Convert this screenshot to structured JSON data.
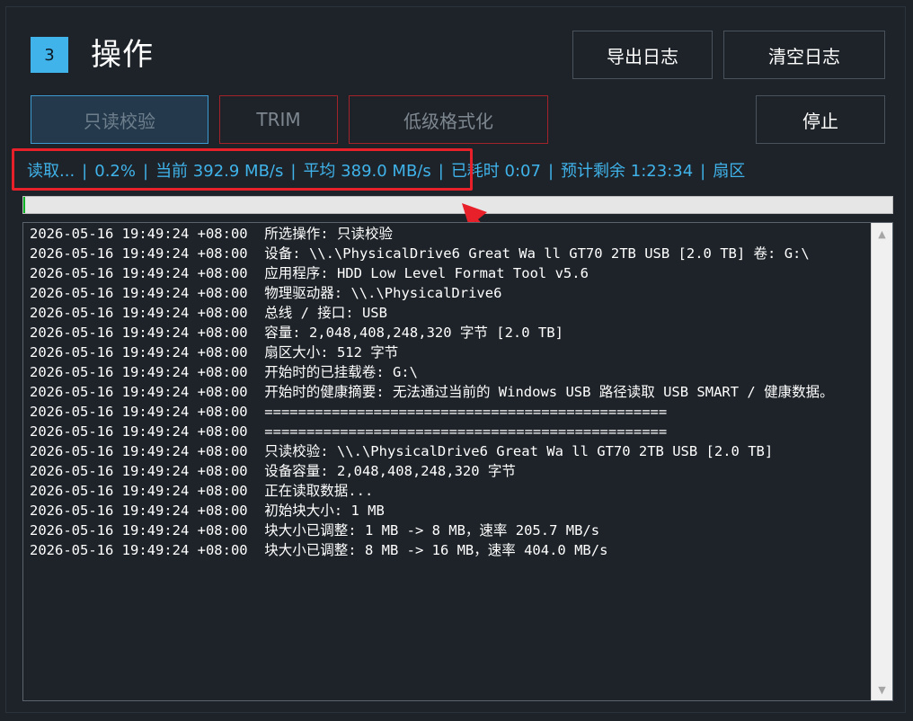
{
  "header": {
    "step_number": "3",
    "title": "操作",
    "export_label": "导出日志",
    "clear_label": "清空日志"
  },
  "actions": {
    "read_verify_label": "只读校验",
    "trim_label": "TRIM",
    "low_format_label": "低级格式化",
    "stop_label": "停止"
  },
  "status": {
    "state": "读取...",
    "percent": "0.2%",
    "current": "当前 392.9 MB/s",
    "average": "平均 389.0 MB/s",
    "elapsed": "已耗时 0:07",
    "remaining": "预计剩余 1:23:34",
    "sector": "扇区"
  },
  "progress": {
    "fraction": 0.002
  },
  "colors": {
    "accent": "#3fb3ea",
    "highlight_red": "#e8202a",
    "progress_green": "#06b025",
    "background": "#1e2329"
  },
  "log": {
    "lines": [
      "2026-05-16 19:49:24 +08:00  所选操作: 只读校验",
      "2026-05-16 19:49:24 +08:00  设备: \\\\.\\PhysicalDrive6 Great Wa ll GT70 2TB USB [2.0 TB] 卷: G:\\",
      "2026-05-16 19:49:24 +08:00  应用程序: HDD Low Level Format Tool v5.6",
      "2026-05-16 19:49:24 +08:00  物理驱动器: \\\\.\\PhysicalDrive6",
      "2026-05-16 19:49:24 +08:00  总线 / 接口: USB",
      "2026-05-16 19:49:24 +08:00  容量: 2,048,408,248,320 字节 [2.0 TB]",
      "2026-05-16 19:49:24 +08:00  扇区大小: 512 字节",
      "2026-05-16 19:49:24 +08:00  开始时的已挂载卷: G:\\",
      "2026-05-16 19:49:24 +08:00  开始时的健康摘要: 无法通过当前的 Windows USB 路径读取 USB SMART / 健康数据。",
      "2026-05-16 19:49:24 +08:00  ================================================",
      "2026-05-16 19:49:24 +08:00  ================================================",
      "2026-05-16 19:49:24 +08:00  只读校验: \\\\.\\PhysicalDrive6 Great Wa ll GT70 2TB USB [2.0 TB]",
      "2026-05-16 19:49:24 +08:00  设备容量: 2,048,408,248,320 字节",
      "2026-05-16 19:49:24 +08:00  正在读取数据...",
      "2026-05-16 19:49:24 +08:00  初始块大小: 1 MB",
      "2026-05-16 19:49:24 +08:00  块大小已调整: 1 MB -> 8 MB，速率 205.7 MB/s",
      "2026-05-16 19:49:24 +08:00  块大小已调整: 8 MB -> 16 MB，速率 404.0 MB/s"
    ]
  },
  "icons": {
    "scroll_up": "scroll-up-arrow-icon",
    "scroll_down": "scroll-down-arrow-icon",
    "annotation": "red-arrow-icon"
  }
}
